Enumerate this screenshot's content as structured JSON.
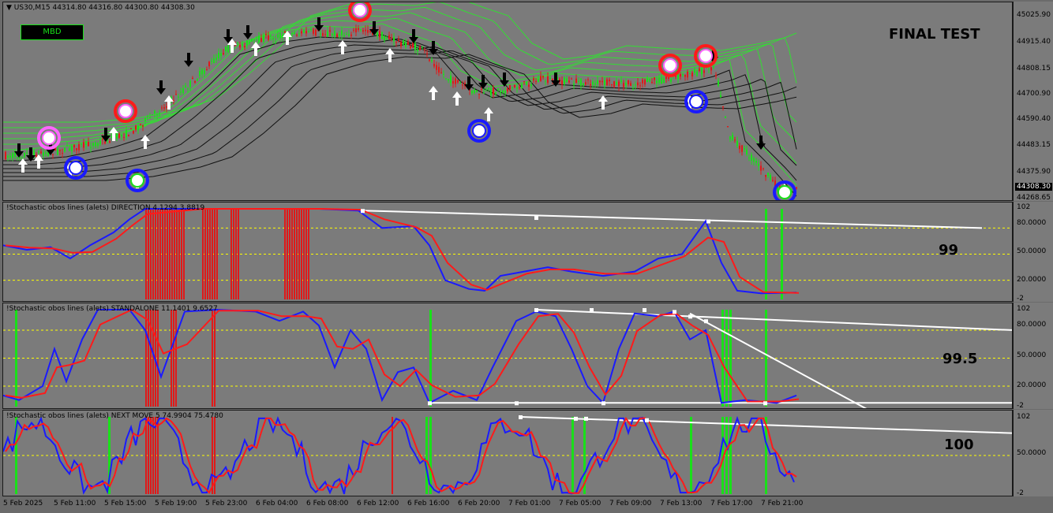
{
  "main": {
    "title": "▼ US30,M15  44314.80 44316.80 44300.80 44308.30",
    "button": "MBD",
    "label": "FINAL TEST",
    "price_ticks": [
      "45025.90",
      "44915.40",
      "44808.15",
      "44700.90",
      "44590.40",
      "44483.15",
      "44375.90",
      "44268.65"
    ],
    "current_price": "44308.30"
  },
  "pane1": {
    "title": "!Stochastic obos lines (alets) DIRECTION 4.1294 3.8819",
    "label": "99",
    "ticks": [
      "102",
      "80.0000",
      "50.0000",
      "20.0000",
      "-2"
    ]
  },
  "pane2": {
    "title": "!Stochastic obos lines (alets) STANDALONE 11.1401 9.6527",
    "label": "99.5",
    "ticks": [
      "102",
      "80.0000",
      "50.0000",
      "20.0000",
      "-2"
    ]
  },
  "pane3": {
    "title": "!Stochastic obos lines (alets) NEXT MOVE 5 74.9904 75.4780",
    "label": "100",
    "ticks": [
      "102",
      "50.0000",
      "-2"
    ]
  },
  "x_axis": [
    "5 Feb 2025",
    "5 Feb 11:00",
    "5 Feb 15:00",
    "5 Feb 19:00",
    "5 Feb 23:00",
    "6 Feb 04:00",
    "6 Feb 08:00",
    "6 Feb 12:00",
    "6 Feb 16:00",
    "6 Feb 20:00",
    "7 Feb 01:00",
    "7 Feb 05:00",
    "7 Feb 09:00",
    "7 Feb 13:00",
    "7 Feb 17:00",
    "7 Feb 21:00"
  ],
  "colors": {
    "bg": "#7b7b7b",
    "bull": "#19e019",
    "bear": "#e01919",
    "stoch_main": "#1a1aff",
    "stoch_signal": "#ff1a1a",
    "level": "#ffff00",
    "ma_green": "#33dd33",
    "ma_black": "#111111"
  }
}
